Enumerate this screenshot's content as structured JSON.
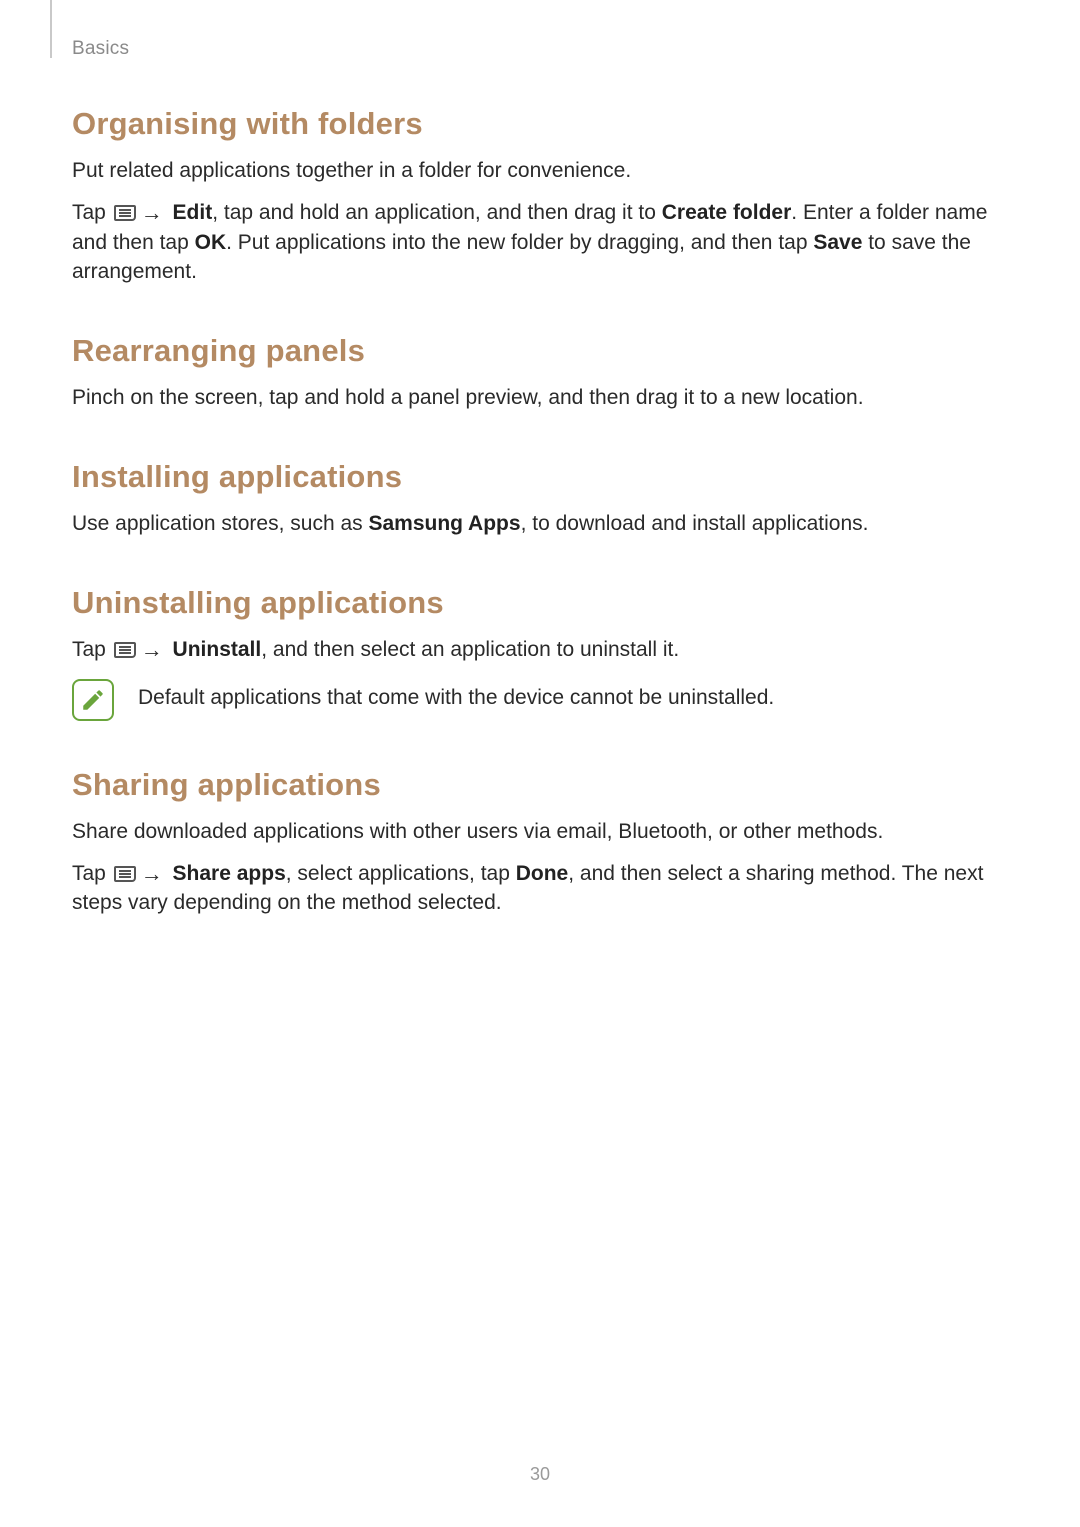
{
  "header": {
    "chapter": "Basics"
  },
  "sections": {
    "organising": {
      "heading": "Organising with folders",
      "p1": "Put related applications together in a folder for convenience.",
      "p2a": "Tap ",
      "p2_bold_edit": "Edit",
      "p2b": ", tap and hold an application, and then drag it to ",
      "p2_bold_create": "Create folder",
      "p2c": ". Enter a folder name and then tap ",
      "p2_bold_ok": "OK",
      "p2d": ". Put applications into the new folder by dragging, and then tap ",
      "p2_bold_save": "Save",
      "p2e": " to save the arrangement."
    },
    "rearranging": {
      "heading": "Rearranging panels",
      "p1": "Pinch on the screen, tap and hold a panel preview, and then drag it to a new location."
    },
    "installing": {
      "heading": "Installing applications",
      "p1a": "Use application stores, such as ",
      "p1_bold": "Samsung Apps",
      "p1b": ", to download and install applications."
    },
    "uninstalling": {
      "heading": "Uninstalling applications",
      "p1a": "Tap ",
      "p1_bold": "Uninstall",
      "p1b": ", and then select an application to uninstall it.",
      "note": "Default applications that come with the device cannot be uninstalled."
    },
    "sharing": {
      "heading": "Sharing applications",
      "p1": "Share downloaded applications with other users via email, Bluetooth, or other methods.",
      "p2a": "Tap ",
      "p2_bold_share": "Share apps",
      "p2b": ", select applications, tap ",
      "p2_bold_done": "Done",
      "p2c": ", and then select a sharing method. The next steps vary depending on the method selected."
    }
  },
  "footer": {
    "page_number": "30"
  },
  "glyphs": {
    "arrow": "→"
  }
}
